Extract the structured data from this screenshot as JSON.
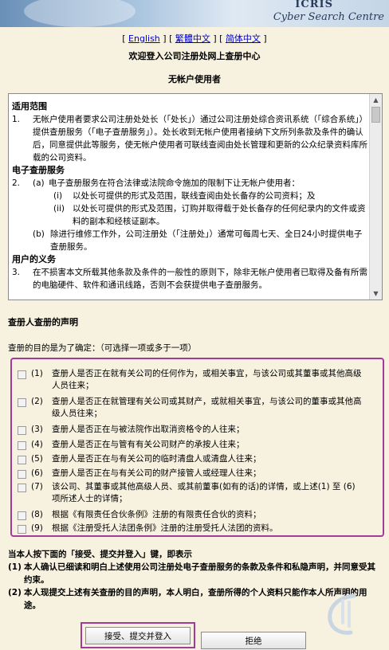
{
  "banner": {
    "brand": "ICRIS",
    "tagline": "Cyber Search Centre"
  },
  "languages": [
    {
      "label": "English"
    },
    {
      "label": "繁體中文"
    },
    {
      "label": "简体中文"
    }
  ],
  "header": {
    "title": "欢迎登入公司注册处网上查册中心",
    "subtitle": "无帐户使用者"
  },
  "terms": {
    "section1_title": "适用范围",
    "item1_num": "1.",
    "item1_text": "无帐户使用者要求公司注册处处长（「处长」）通过公司注册处综合资讯系统（「综合系统」）提供查册服务（「电子查册服务」）。处长收到无帐户使用者接纳下文所列条款及条件的确认后，同意提供此等服务，使无帐户使用者可联线查阅由处长管理和更新的公众纪录资料库所载的公司资料。",
    "section2_title": "电子查册服务",
    "item2_num": "2.",
    "item2a_num": "(a)",
    "item2a_text": "电子查册服务在符合法律或法院命令施加的限制下让无帐户使用者：",
    "item2a_i_num": "(i)",
    "item2a_i_text": "以处长可提供的形式及范围，联线查阅由处长备存的公司资料；及",
    "item2a_ii_num": "(ii)",
    "item2a_ii_text": "以处长可提供的形式及范围，订购并取得载于处长备存的任何纪录内的文件或资料的副本和经核证副本。",
    "item2b_num": "(b)",
    "item2b_text": "除进行维修工作外，公司注册处（「注册处」）通常可每周七天、全日24小时提供电子查册服务。",
    "section3_title": "用户的义务",
    "item3_num": "3.",
    "item3_text": "在不损害本文所载其他条款及条件的一般性的原则下，除非无帐户使用者已取得及备有所需的电脑硬件、软件和通讯线路，否则不会获提供电子查册服务。"
  },
  "declaration": {
    "title": "查册人查册的声明",
    "purpose_prompt": "查册的目的是为了确定：（可选择一项或多于一项）",
    "items": [
      {
        "num": "(1)",
        "text": "查册人是否正在就有关公司的任何作为，或相关事宜，与该公司或其董事或其他高级人员往来；"
      },
      {
        "num": "(2)",
        "text": "查册人是否正在就管理有关公司或其财产，或就相关事宜，与该公司的董事或其他高级人员往来；"
      },
      {
        "num": "(3)",
        "text": "查册人是否正在与被法院作出取消资格令的人往来；"
      },
      {
        "num": "(4)",
        "text": "查册人是否正在与管有有关公司财产的承按人往来；"
      },
      {
        "num": "(5)",
        "text": "查册人是否正在与有关公司的临时清盘人或清盘人往来；"
      },
      {
        "num": "(6)",
        "text": "查册人是否正在与有关公司的财产接管人或经理人往来；"
      },
      {
        "num": "(7)",
        "text": "该公司、其董事或其他高级人员、或其前董事(如有的话)的详情，或上述(1) 至 (6) 项所述人士的详情；"
      },
      {
        "num": "(8)",
        "text": "根据《有限责任合伙条例》注册的有限责任合伙的资料；"
      },
      {
        "num": "(9)",
        "text": "根据《注册受托人法团条例》注册的注册受托人法团的资料。"
      }
    ]
  },
  "statement": {
    "intro": "当本人按下面的「接受、提交并登入」键，即表示",
    "item1_num": "(1)",
    "item1_text": "本人确认已细读和明白上述使用公司注册处电子查册服务的条款及条件和私隐声明，并同意受其约束。",
    "item2_num": "(2)",
    "item2_text": "本人现提交上述有关查册的目的声明，本人明白，查册所得的个人资料只能作本人所声明的用途。"
  },
  "buttons": {
    "accept_label": "接受、提交并登入",
    "reject_label": "拒绝"
  },
  "colors": {
    "page_background": "#f7f2e0",
    "highlight_border": "#a23a9a",
    "link": "#0000cc"
  }
}
